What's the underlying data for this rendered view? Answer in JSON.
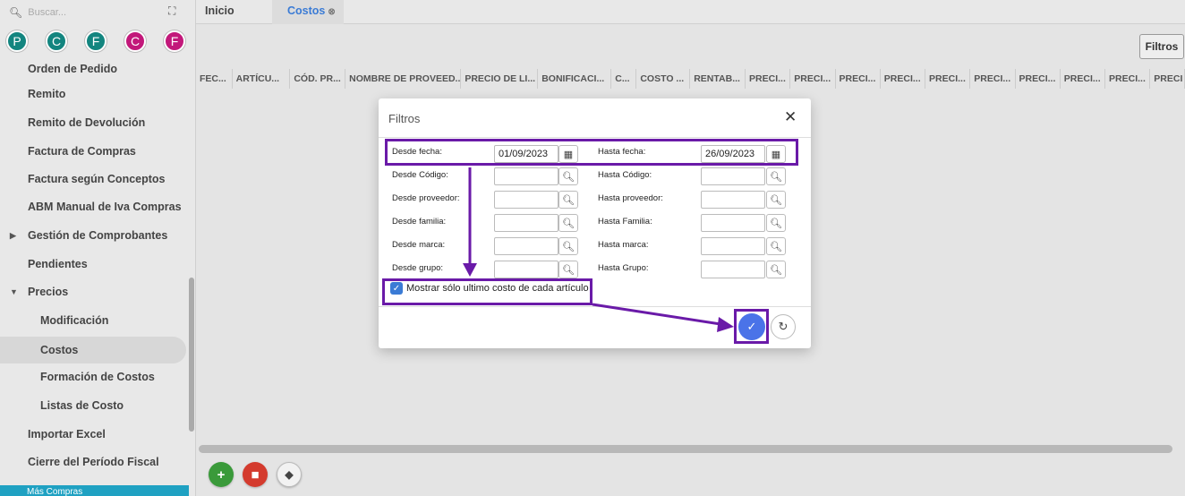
{
  "sidebar": {
    "search_placeholder": "Buscar...",
    "shortcuts": [
      {
        "letter": "P",
        "color": "#13857f"
      },
      {
        "letter": "C",
        "color": "#13857f"
      },
      {
        "letter": "F",
        "color": "#13857f"
      },
      {
        "letter": "C",
        "color": "#c2187a"
      },
      {
        "letter": "F",
        "color": "#c2187a"
      }
    ],
    "items": [
      {
        "label": "Orden de Pedido"
      },
      {
        "label": "Remito"
      },
      {
        "label": "Remito de Devolución"
      },
      {
        "label": "Factura de Compras"
      },
      {
        "label": "Factura según Conceptos"
      },
      {
        "label": "ABM Manual de Iva Compras"
      },
      {
        "label": "Gestión de Comprobantes"
      },
      {
        "label": "Pendientes"
      },
      {
        "label": "Precios"
      },
      {
        "label": "Modificación"
      },
      {
        "label": "Costos"
      },
      {
        "label": "Formación de Costos"
      },
      {
        "label": "Listas de Costo"
      },
      {
        "label": "Importar Excel"
      },
      {
        "label": "Cierre del Período Fiscal"
      }
    ],
    "footer_label": "Más Compras"
  },
  "tabs": {
    "inicio": "Inicio",
    "costos": "Costos"
  },
  "toolbar": {
    "filtros_label": "Filtros"
  },
  "grid": {
    "columns": [
      "FEC...",
      "ARTÍCU...",
      "CÓD. PR...",
      "NOMBRE DE PROVEED...",
      "PRECIO DE LI...",
      "BONIFICACI...",
      "C...",
      "COSTO ...",
      "RENTAB...",
      "PRECI...",
      "PRECI...",
      "PRECI...",
      "PRECI...",
      "PRECI...",
      "PRECI...",
      "PRECI...",
      "PRECI...",
      "PRECI...",
      "PRECI"
    ]
  },
  "modal": {
    "title": "Filtros",
    "desde_fecha_label": "Desde fecha:",
    "desde_fecha_value": "01/09/2023",
    "hasta_fecha_label": "Hasta fecha:",
    "hasta_fecha_value": "26/09/2023",
    "desde_codigo_label": "Desde Código:",
    "hasta_codigo_label": "Hasta Código:",
    "desde_proveedor_label": "Desde proveedor:",
    "hasta_proveedor_label": "Hasta proveedor:",
    "desde_familia_label": "Desde familia:",
    "hasta_familia_label": "Hasta Familia:",
    "desde_marca_label": "Desde marca:",
    "hasta_marca_label": "Hasta marca:",
    "desde_grupo_label": "Desde grupo:",
    "hasta_grupo_label": "Hasta Grupo:",
    "checkbox_label": "Mostrar sólo ultimo costo de cada artículo",
    "checkbox_checked": true
  },
  "colors": {
    "accent": "#3a7bd5",
    "highlight": "#6a1aa8",
    "confirm": "#4a73e8"
  }
}
